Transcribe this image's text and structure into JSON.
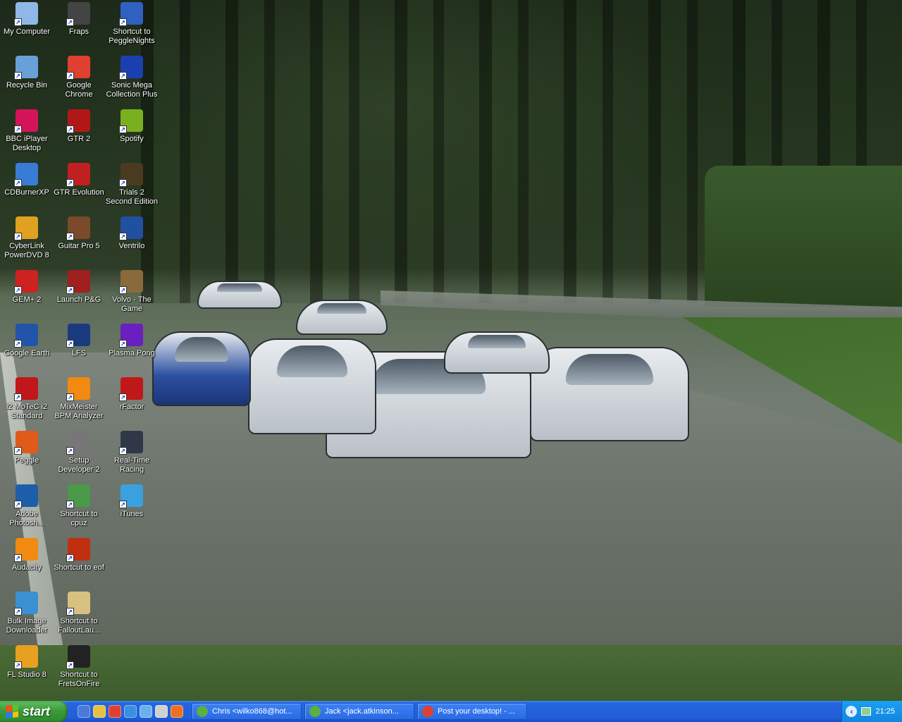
{
  "desktop": {
    "icons": [
      {
        "label": "My Computer",
        "icon": "computer-icon",
        "color": "#8fb8e8"
      },
      {
        "label": "Recycle Bin",
        "icon": "recycle-bin-icon",
        "color": "#6aa0d8"
      },
      {
        "label": "BBC iPlayer Desktop",
        "icon": "bbc-iplayer-icon",
        "color": "#d4145a"
      },
      {
        "label": "CDBurnerXP",
        "icon": "cdburnerxp-icon",
        "color": "#3a7bd5"
      },
      {
        "label": "CyberLink PowerDVD 8",
        "icon": "powerdvd-icon",
        "color": "#e0a020"
      },
      {
        "label": "GEM+ 2",
        "icon": "gem-icon",
        "color": "#cc2222"
      },
      {
        "label": "Google Earth",
        "icon": "google-earth-icon",
        "color": "#2255aa"
      },
      {
        "label": "i2 MoTeC i2 Standard",
        "icon": "motec-icon",
        "color": "#c0161c"
      },
      {
        "label": "Peggle",
        "icon": "peggle-icon",
        "color": "#e05a1a"
      },
      {
        "label": "Adobe Photosh...",
        "icon": "photoshop-icon",
        "color": "#1c5fa8"
      },
      {
        "label": "Audacity",
        "icon": "audacity-icon",
        "color": "#f08a10"
      },
      {
        "label": "Bulk Image Downloader",
        "icon": "bulk-image-downloader-icon",
        "color": "#3a90d0"
      },
      {
        "label": "FL Studio 8",
        "icon": "fl-studio-icon",
        "color": "#e8a020"
      },
      {
        "label": "Fraps",
        "icon": "fraps-icon",
        "color": "#444444"
      },
      {
        "label": "Google Chrome",
        "icon": "chrome-icon",
        "color": "#e04030"
      },
      {
        "label": "GTR 2",
        "icon": "gtr2-icon",
        "color": "#b01818"
      },
      {
        "label": "GTR Evolution",
        "icon": "gtr-evolution-icon",
        "color": "#c02020"
      },
      {
        "label": "Guitar Pro 5",
        "icon": "guitar-pro-icon",
        "color": "#7a4a2a"
      },
      {
        "label": "Launch P&G",
        "icon": "launch-pg-icon",
        "color": "#a02020"
      },
      {
        "label": "LFS",
        "icon": "lfs-icon",
        "color": "#1a3a80"
      },
      {
        "label": "MixMeister BPM Analyzer",
        "icon": "mixmeister-icon",
        "color": "#f08a10"
      },
      {
        "label": "Setup Developer 2",
        "icon": "setup-developer-icon",
        "color": "#777777"
      },
      {
        "label": "Shortcut to cpuz",
        "icon": "cpuz-icon",
        "color": "#4a9a4a"
      },
      {
        "label": "Shortcut to eof",
        "icon": "eof-icon",
        "color": "#c03010"
      },
      {
        "label": "Shortcut to FalloutLau...",
        "icon": "fallout-icon",
        "color": "#d8c080"
      },
      {
        "label": "Shortcut to FretsOnFire",
        "icon": "frets-on-fire-icon",
        "color": "#222222"
      },
      {
        "label": "Shortcut to PeggleNights",
        "icon": "peggle-nights-icon",
        "color": "#3060c0"
      },
      {
        "label": "Sonic Mega Collection Plus",
        "icon": "sonic-icon",
        "color": "#1a40b0"
      },
      {
        "label": "Spotify",
        "icon": "spotify-icon",
        "color": "#7ab020"
      },
      {
        "label": "Trials 2 Second Edition",
        "icon": "trials-icon",
        "color": "#4a3a20"
      },
      {
        "label": "Ventrilo",
        "icon": "ventrilo-icon",
        "color": "#2050a0"
      },
      {
        "label": "Volvo - The Game",
        "icon": "volvo-icon",
        "color": "#8a6a3a"
      },
      {
        "label": "Plasma Pong",
        "icon": "plasma-pong-icon",
        "color": "#6a20c0"
      },
      {
        "label": "rFactor",
        "icon": "rfactor-icon",
        "color": "#c01818"
      },
      {
        "label": "Real-Time Racing",
        "icon": "real-time-racing-icon",
        "color": "#303848"
      },
      {
        "label": "iTunes",
        "icon": "itunes-icon",
        "color": "#3aa0e0"
      }
    ]
  },
  "taskbar": {
    "start_label": "start",
    "quick_launch": [
      {
        "icon": "show-desktop-icon",
        "color": "#4a7ad8"
      },
      {
        "icon": "explorer-icon",
        "color": "#e8c040"
      },
      {
        "icon": "chrome-icon",
        "color": "#e04030"
      },
      {
        "icon": "ie-icon",
        "color": "#3a90e0"
      },
      {
        "icon": "media-icon",
        "color": "#6ab0f0"
      },
      {
        "icon": "steam-icon",
        "color": "#d0d0d0"
      },
      {
        "icon": "firefox-icon",
        "color": "#f07020"
      }
    ],
    "tasks": [
      {
        "label": "Chris <wilko868@hot...",
        "icon": "messenger-icon",
        "color": "#5ab040"
      },
      {
        "label": "Jack <jack.atkinson...",
        "icon": "messenger-icon",
        "color": "#5ab040"
      },
      {
        "label": "Post your desktop! - ...",
        "icon": "chrome-icon",
        "color": "#e04030"
      }
    ],
    "clock": "21:25"
  }
}
